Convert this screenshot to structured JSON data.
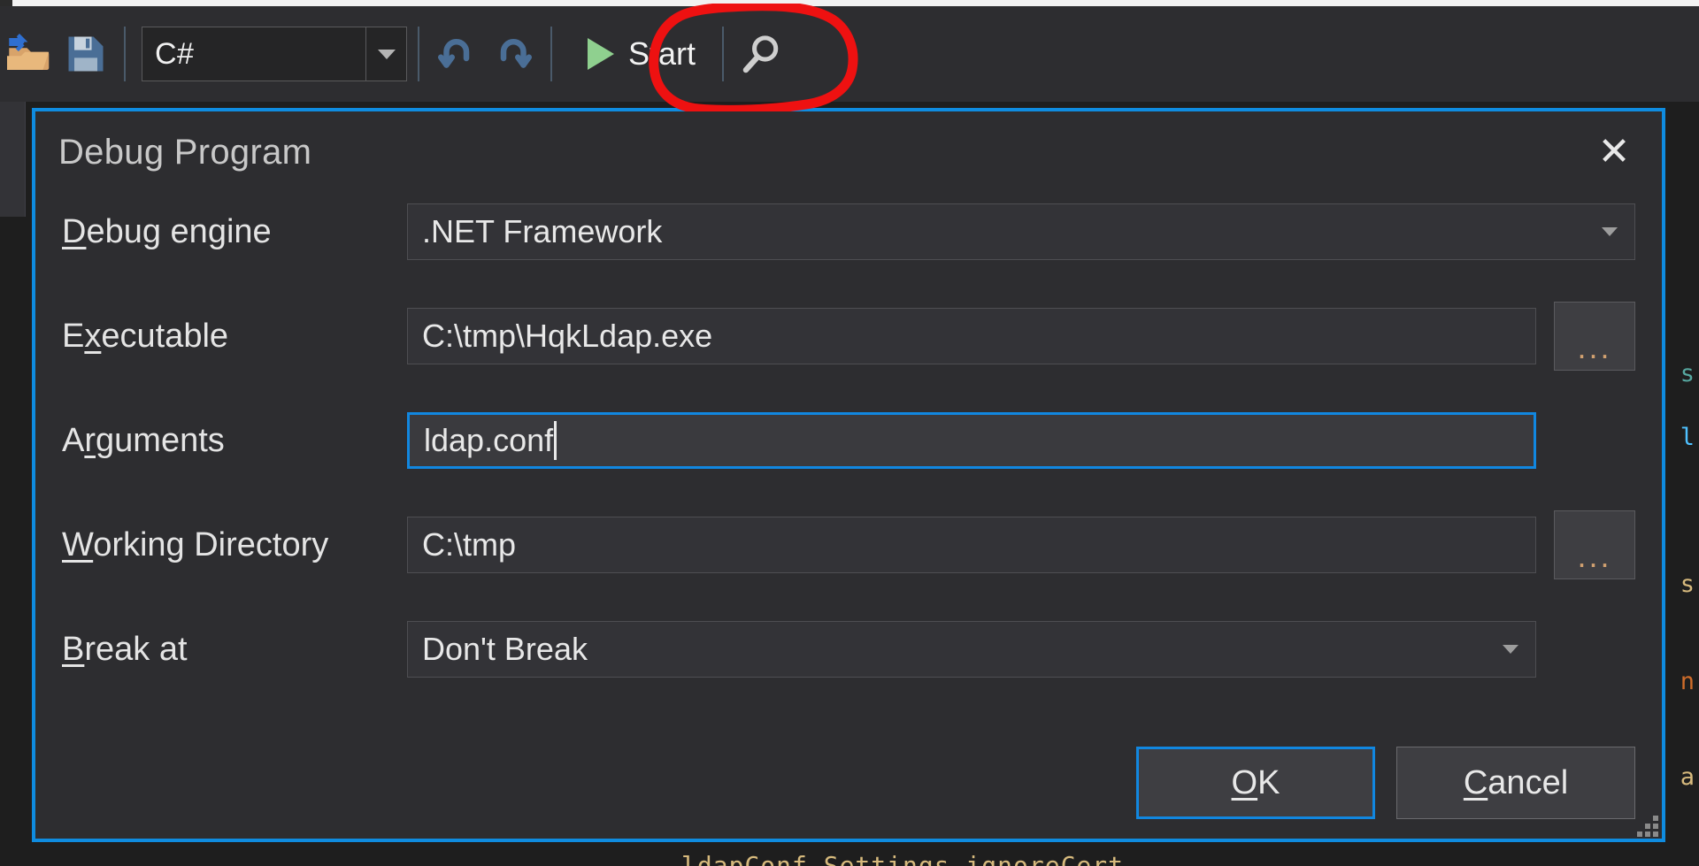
{
  "toolbar": {
    "icons": [
      {
        "name": "open-folder-icon",
        "glyph": "open-folder"
      },
      {
        "name": "save-icon",
        "glyph": "save"
      },
      {
        "name": "undo-icon",
        "glyph": "undo"
      },
      {
        "name": "redo-icon",
        "glyph": "redo"
      },
      {
        "name": "search-icon",
        "glyph": "magnifier"
      }
    ],
    "language_combo": {
      "value": "C#",
      "arrow": "chevron-down-icon"
    },
    "start_button": {
      "label": "Start",
      "icon": "play-triangle-icon",
      "icon_color": "#8fd08f"
    },
    "annotation": {
      "shape": "hand-drawn-circle",
      "color": "#ee1111",
      "targets": "start-button"
    }
  },
  "dialog": {
    "title": "Debug Program",
    "close_label": "✕",
    "border_color": "#0f8ce0",
    "fields": [
      {
        "id": "debug-engine",
        "label_pre": "",
        "label_acc": "D",
        "label_post": "ebug engine",
        "label_full": "Debug engine",
        "type": "combobox",
        "value": ".NET Framework",
        "focused": false,
        "has_browse": false
      },
      {
        "id": "executable",
        "label_pre": "E",
        "label_acc": "x",
        "label_post": "ecutable",
        "label_full": "Executable",
        "type": "text",
        "value": "C:\\tmp\\HqkLdap.exe",
        "focused": false,
        "has_browse": true,
        "browse_label": "..."
      },
      {
        "id": "arguments",
        "label_pre": "A",
        "label_acc": "r",
        "label_post": "guments",
        "label_full": "Arguments",
        "type": "text",
        "value": "ldap.conf",
        "focused": true,
        "has_caret": true,
        "has_browse": false
      },
      {
        "id": "working-directory",
        "label_pre": "",
        "label_acc": "W",
        "label_post": "orking Directory",
        "label_full": "Working Directory",
        "type": "text",
        "value": "C:\\tmp",
        "focused": false,
        "has_browse": true,
        "browse_label": "..."
      },
      {
        "id": "break-at",
        "label_pre": "",
        "label_acc": "B",
        "label_post": "reak at",
        "label_full": "Break at",
        "type": "combobox",
        "value": "Don't Break",
        "focused": false,
        "has_browse": false
      }
    ],
    "buttons": [
      {
        "id": "ok",
        "pre": "",
        "acc": "O",
        "post": "K",
        "full": "OK",
        "default": true
      },
      {
        "id": "cancel",
        "pre": "",
        "acc": "C",
        "post": "ancel",
        "full": "Cancel",
        "default": false
      }
    ],
    "resize_grip": "resize-grip"
  },
  "background_code": {
    "right_edge_chars": [
      "s",
      "l",
      "s",
      "n",
      "a"
    ],
    "bottom_line": "ldapConf.Settings.ignoreCert"
  }
}
